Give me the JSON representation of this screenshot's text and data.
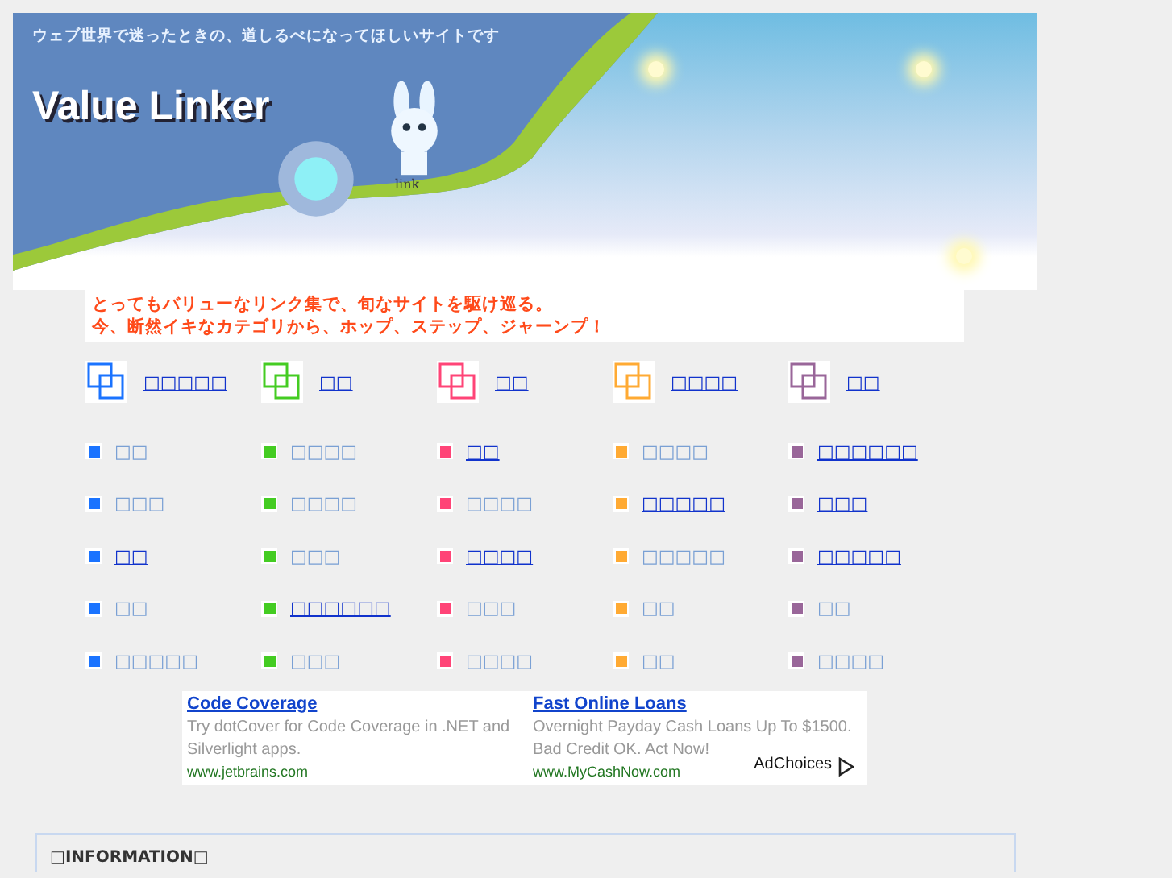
{
  "banner": {
    "tagline": "ウェブ世界で迷ったときの、道しるべになってほしいサイトです",
    "title": "Value Linker",
    "badge": "link"
  },
  "intro": [
    "とってもバリューなリンク集で、旬なサイトを駆け巡る。",
    "今、断然イキなカテゴリから、ホップ、ステップ、ジャーンプ！"
  ],
  "categories": [
    {
      "title": "□□□□□",
      "color": "#1a73ff",
      "items": [
        {
          "label": "□□",
          "visited": true
        },
        {
          "label": "□□□",
          "visited": true
        },
        {
          "label": "□□",
          "visited": false
        },
        {
          "label": "□□",
          "visited": true
        },
        {
          "label": "□□□□□",
          "visited": true
        }
      ]
    },
    {
      "title": "□□",
      "color": "#44cc22",
      "items": [
        {
          "label": "□□□□",
          "visited": true
        },
        {
          "label": "□□□□",
          "visited": true
        },
        {
          "label": "□□□",
          "visited": true
        },
        {
          "label": "□□□□□□",
          "visited": false
        },
        {
          "label": "□□□",
          "visited": true
        }
      ]
    },
    {
      "title": "□□",
      "color": "#ff4477",
      "items": [
        {
          "label": "□□",
          "visited": false
        },
        {
          "label": "□□□□",
          "visited": true
        },
        {
          "label": "□□□□",
          "visited": false
        },
        {
          "label": "□□□",
          "visited": true
        },
        {
          "label": "□□□□",
          "visited": true
        }
      ]
    },
    {
      "title": "□□□□",
      "color": "#ffaa33",
      "items": [
        {
          "label": "□□□□",
          "visited": true
        },
        {
          "label": "□□□□□",
          "visited": false
        },
        {
          "label": "□□□□□",
          "visited": true
        },
        {
          "label": "□□",
          "visited": true
        },
        {
          "label": "□□",
          "visited": true
        }
      ]
    },
    {
      "title": "□□",
      "color": "#996699",
      "items": [
        {
          "label": "□□□□□□",
          "visited": false
        },
        {
          "label": "□□□",
          "visited": false
        },
        {
          "label": "□□□□□",
          "visited": false
        },
        {
          "label": "□□",
          "visited": true
        },
        {
          "label": "□□□□",
          "visited": true
        }
      ]
    }
  ],
  "ads": [
    {
      "title": "Code Coverage",
      "text": "Try dotCover for Code Coverage in .NET and Silverlight apps.",
      "url": "www.jetbrains.com"
    },
    {
      "title": "Fast Online Loans",
      "text": "Overnight Payday Cash Loans Up To $1500. Bad Credit OK. Act Now!",
      "url": "www.MyCashNow.com"
    }
  ],
  "adchoices": "AdChoices",
  "information": {
    "title": "□INFORMATION□"
  }
}
